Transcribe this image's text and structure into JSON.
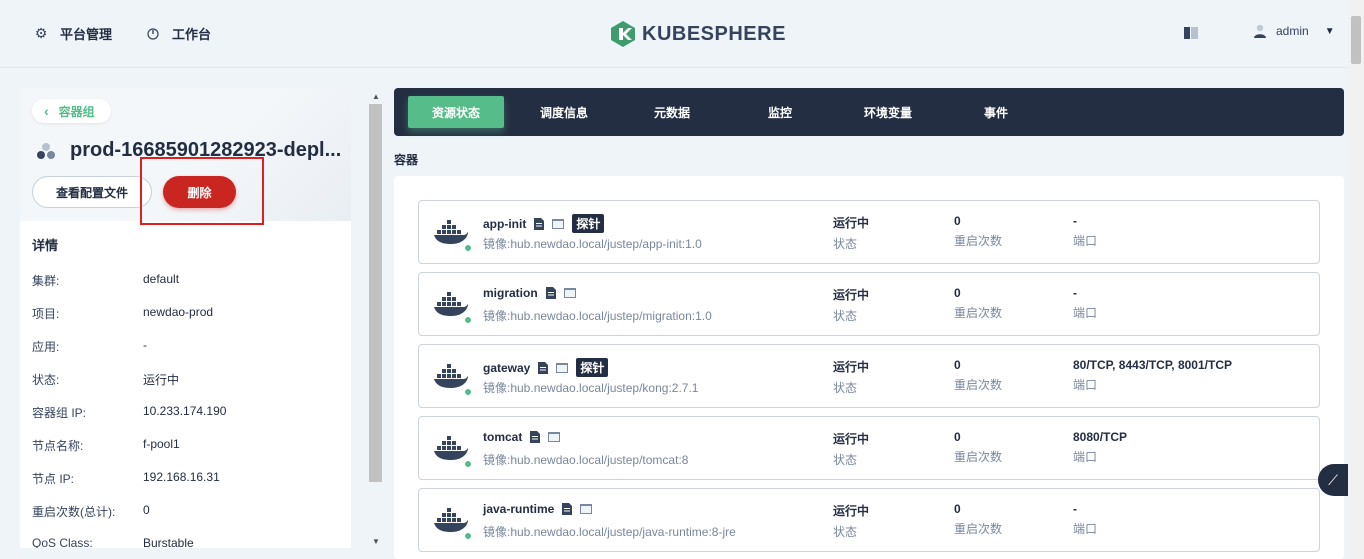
{
  "header": {
    "nav_platform": "平台管理",
    "nav_workbench": "工作台",
    "logo_text": "KUBESPHERE",
    "username": "admin"
  },
  "left": {
    "back_label": "容器组",
    "pod_name": "prod-16685901282923-depl...",
    "view_config_label": "查看配置文件",
    "delete_label": "删除",
    "details_title": "详情",
    "details": [
      {
        "key": "集群:",
        "value": "default"
      },
      {
        "key": "项目:",
        "value": "newdao-prod"
      },
      {
        "key": "应用:",
        "value": "-"
      },
      {
        "key": "状态:",
        "value": "运行中"
      },
      {
        "key": "容器组 IP:",
        "value": "10.233.174.190"
      },
      {
        "key": "节点名称:",
        "value": "f-pool1"
      },
      {
        "key": "节点 IP:",
        "value": "192.168.16.31"
      },
      {
        "key": "重启次数(总计):",
        "value": "0"
      },
      {
        "key": "QoS Class:",
        "value": "Burstable"
      }
    ]
  },
  "tabs": [
    "资源状态",
    "调度信息",
    "元数据",
    "监控",
    "环境变量",
    "事件"
  ],
  "section_title": "容器",
  "containers": [
    {
      "name": "app-init",
      "probe": "探针",
      "image": "镜像:hub.newdao.local/justep/app-init:1.0",
      "status": "运行中",
      "status_label": "状态",
      "restarts": "0",
      "restarts_label": "重启次数",
      "ports": "-",
      "ports_label": "端口"
    },
    {
      "name": "migration",
      "probe": "",
      "image": "镜像:hub.newdao.local/justep/migration:1.0",
      "status": "运行中",
      "status_label": "状态",
      "restarts": "0",
      "restarts_label": "重启次数",
      "ports": "-",
      "ports_label": "端口"
    },
    {
      "name": "gateway",
      "probe": "探针",
      "image": "镜像:hub.newdao.local/justep/kong:2.7.1",
      "status": "运行中",
      "status_label": "状态",
      "restarts": "0",
      "restarts_label": "重启次数",
      "ports": "80/TCP, 8443/TCP, 8001/TCP",
      "ports_label": "端口"
    },
    {
      "name": "tomcat",
      "probe": "",
      "image": "镜像:hub.newdao.local/justep/tomcat:8",
      "status": "运行中",
      "status_label": "状态",
      "restarts": "0",
      "restarts_label": "重启次数",
      "ports": "8080/TCP",
      "ports_label": "端口"
    },
    {
      "name": "java-runtime",
      "probe": "",
      "image": "镜像:hub.newdao.local/justep/java-runtime:8-jre",
      "status": "运行中",
      "status_label": "状态",
      "restarts": "0",
      "restarts_label": "重启次数",
      "ports": "-",
      "ports_label": "端口"
    }
  ],
  "colors": {
    "accent": "#55bc8a",
    "danger": "#ca2621",
    "dark": "#242e42",
    "highlight": "#e02020"
  }
}
